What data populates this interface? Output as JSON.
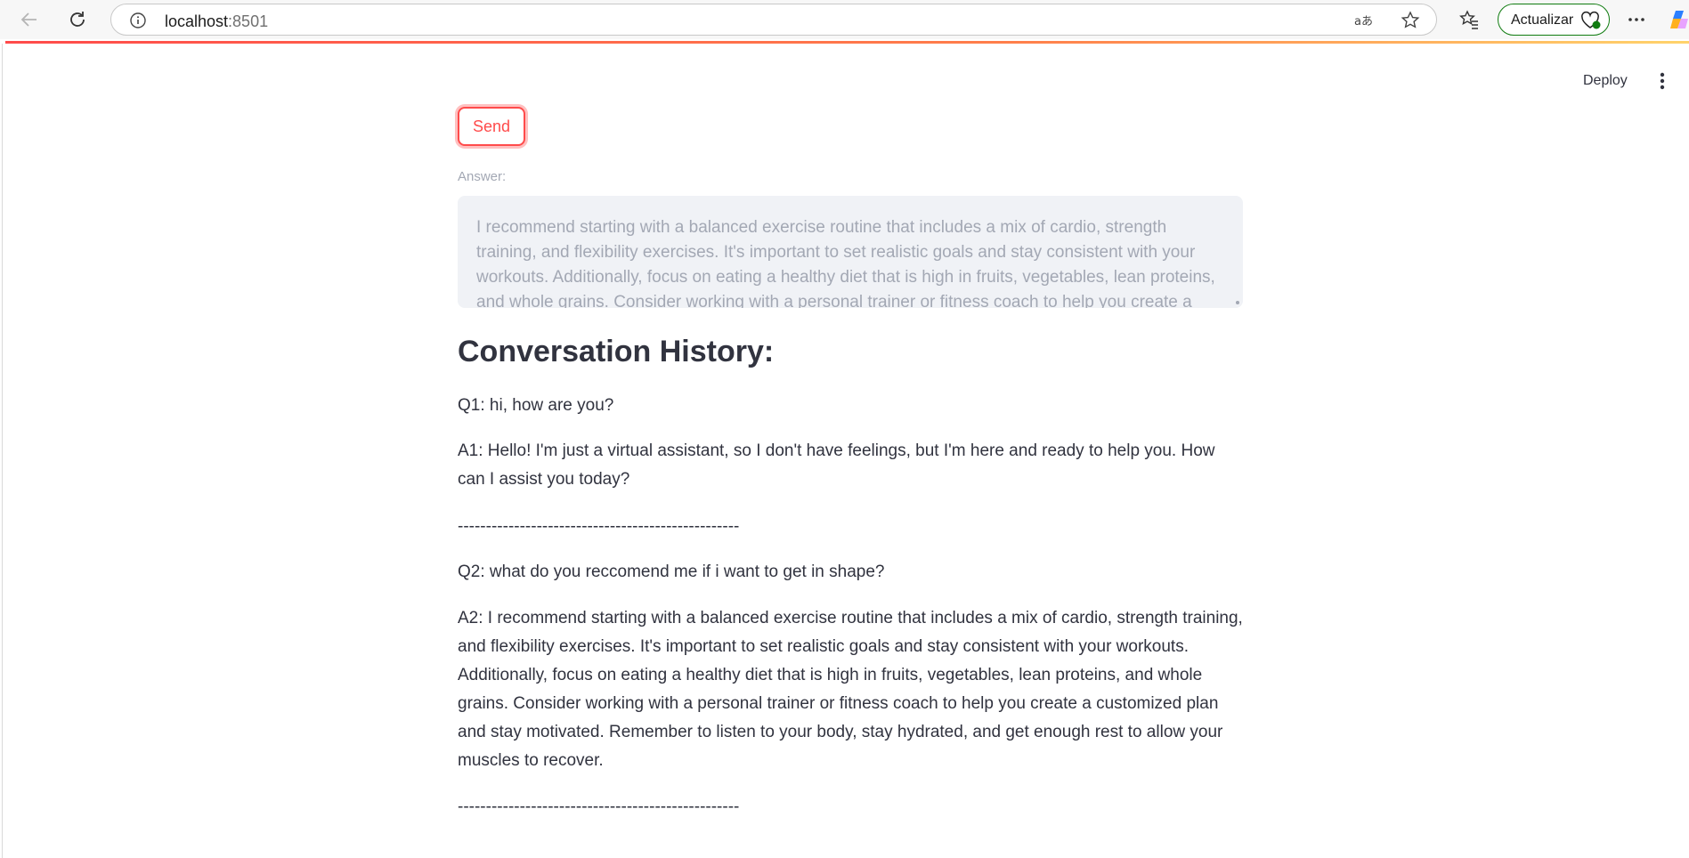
{
  "browser": {
    "url_host": "localhost",
    "url_port": ":8501",
    "update_label": "Actualizar"
  },
  "toolbar": {
    "deploy_label": "Deploy"
  },
  "form": {
    "send_label": "Send"
  },
  "answer": {
    "label": "Answer:",
    "value": "I recommend starting with a balanced exercise routine that includes a mix of cardio, strength training, and flexibility exercises. It's important to set realistic goals and stay consistent with your workouts. Additionally, focus on eating a healthy diet that is high in fruits, vegetables, lean proteins, and whole grains. Consider working with a personal trainer or fitness coach to help you create a customized plan and stay motivated. Remember to listen to your body, stay hydrated, and get enough rest to allow your muscles to recover."
  },
  "history": {
    "title": "Conversation History:",
    "q1": "Q1: hi, how are you?",
    "a1": "A1: Hello! I'm just a virtual assistant, so I don't have feelings, but I'm here and ready to help you. How can I assist you today?",
    "sep1": "--------------------------------------------------",
    "q2": "Q2: what do you reccomend me if i want to get in shape?",
    "a2": "A2: I recommend starting with a balanced exercise routine that includes a mix of cardio, strength training, and flexibility exercises. It's important to set realistic goals and stay consistent with your workouts. Additionally, focus on eating a healthy diet that is high in fruits, vegetables, lean proteins, and whole grains. Consider working with a personal trainer or fitness coach to help you create a customized plan and stay motivated. Remember to listen to your body, stay hydrated, and get enough rest to allow your muscles to recover.",
    "sep2": "--------------------------------------------------"
  },
  "colors": {
    "accent": "#ff4b4b",
    "text": "#31333f",
    "muted": "#a3a8b4",
    "input_bg": "#f0f2f6",
    "update_border": "#107c10"
  },
  "icons": [
    "back-arrow-icon",
    "reload-icon",
    "info-icon",
    "read-aloud-icon",
    "star-icon",
    "favorites-icon",
    "heart-icon",
    "more-icon",
    "copilot-icon",
    "kebab-menu-icon"
  ]
}
